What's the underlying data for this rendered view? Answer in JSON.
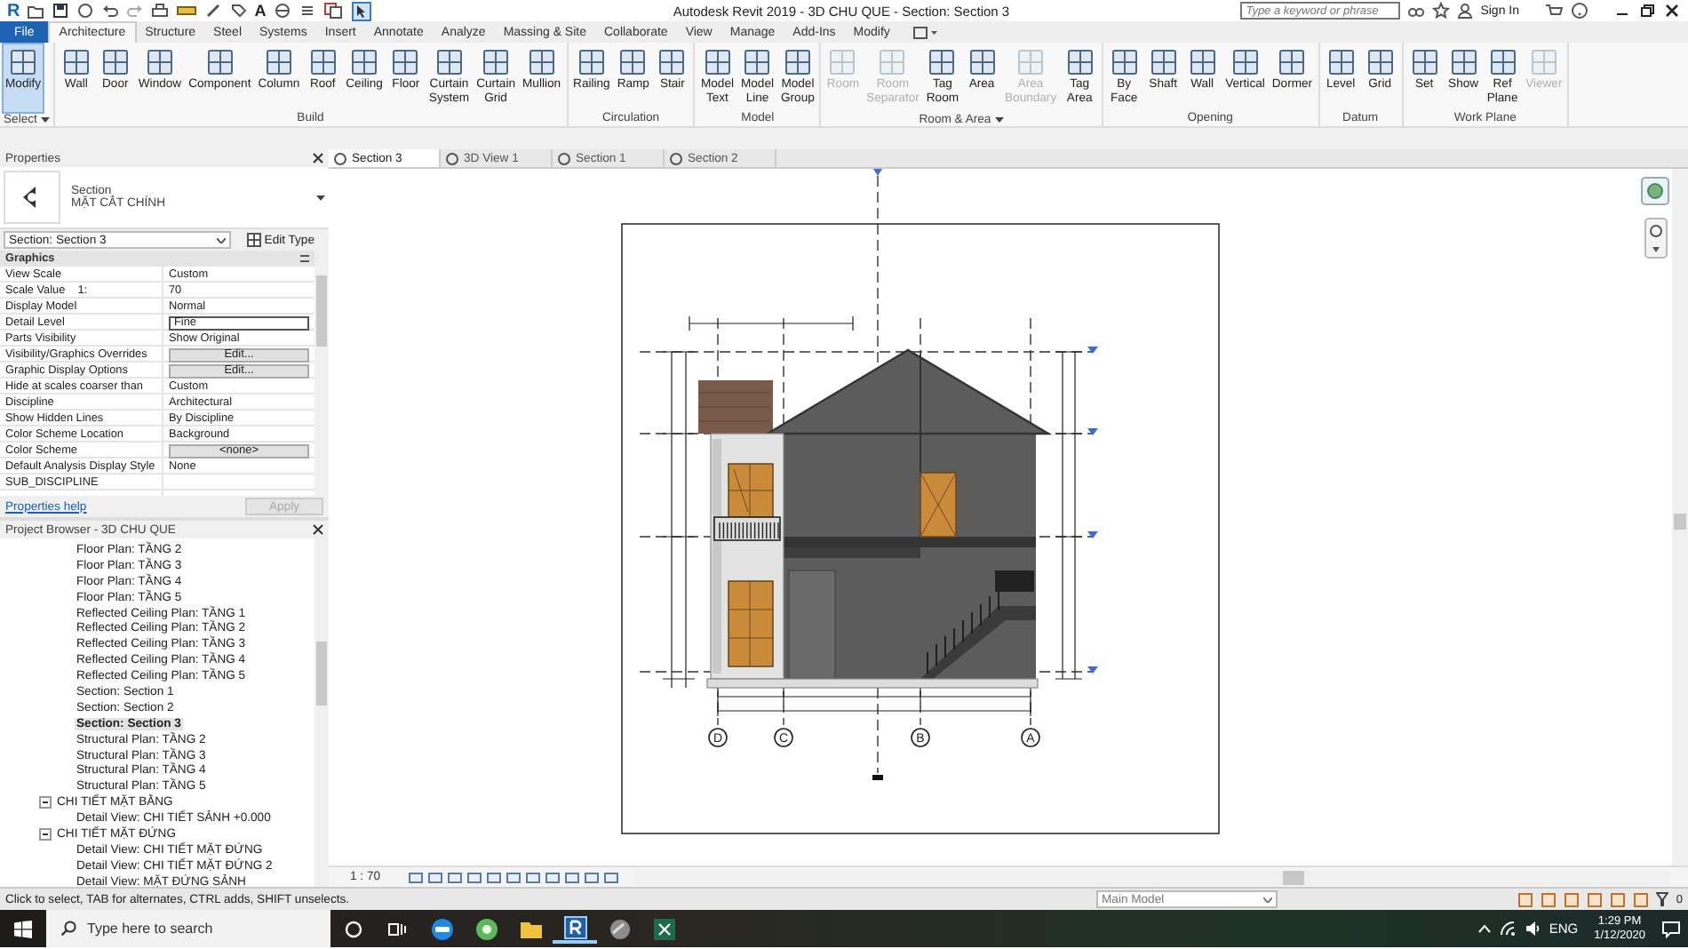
{
  "title_bar": {
    "logo": "R",
    "text_tool": "A",
    "title": "Autodesk Revit 2019 - 3D CHU QUE - Section: Section 3",
    "search_placeholder": "Type a keyword or phrase",
    "sign_in": "Sign In"
  },
  "ribbon_tabs": [
    {
      "label": "File",
      "kind": "file",
      "selected": false
    },
    {
      "label": "Architecture",
      "kind": "tab",
      "selected": true
    },
    {
      "label": "Structure",
      "kind": "tab",
      "selected": false
    },
    {
      "label": "Steel",
      "kind": "tab",
      "selected": false
    },
    {
      "label": "Systems",
      "kind": "tab",
      "selected": false
    },
    {
      "label": "Insert",
      "kind": "tab",
      "selected": false
    },
    {
      "label": "Annotate",
      "kind": "tab",
      "selected": false
    },
    {
      "label": "Analyze",
      "kind": "tab",
      "selected": false
    },
    {
      "label": "Massing & Site",
      "kind": "tab",
      "selected": false
    },
    {
      "label": "Collaborate",
      "kind": "tab",
      "selected": false
    },
    {
      "label": "View",
      "kind": "tab",
      "selected": false
    },
    {
      "label": "Manage",
      "kind": "tab",
      "selected": false
    },
    {
      "label": "Add-Ins",
      "kind": "tab",
      "selected": false
    },
    {
      "label": "Modify",
      "kind": "tab",
      "selected": false
    }
  ],
  "ribbon_groups": [
    {
      "label": "Select",
      "menu": true,
      "buttons": [
        {
          "label": "Modify",
          "selected": true,
          "disabled": false
        }
      ]
    },
    {
      "label": "Build",
      "menu": false,
      "buttons": [
        {
          "label": "Wall",
          "selected": false,
          "disabled": false
        },
        {
          "label": "Door",
          "selected": false,
          "disabled": false
        },
        {
          "label": "Window",
          "selected": false,
          "disabled": false
        },
        {
          "label": "Component",
          "selected": false,
          "disabled": false
        },
        {
          "label": "Column",
          "selected": false,
          "disabled": false
        },
        {
          "label": "Roof",
          "selected": false,
          "disabled": false
        },
        {
          "label": "Ceiling",
          "selected": false,
          "disabled": false
        },
        {
          "label": "Floor",
          "selected": false,
          "disabled": false
        },
        {
          "label": "Curtain System",
          "selected": false,
          "disabled": false
        },
        {
          "label": "Curtain Grid",
          "selected": false,
          "disabled": false
        },
        {
          "label": "Mullion",
          "selected": false,
          "disabled": false
        }
      ]
    },
    {
      "label": "Circulation",
      "menu": false,
      "buttons": [
        {
          "label": "Railing",
          "selected": false,
          "disabled": false
        },
        {
          "label": "Ramp",
          "selected": false,
          "disabled": false
        },
        {
          "label": "Stair",
          "selected": false,
          "disabled": false
        }
      ]
    },
    {
      "label": "Model",
      "menu": false,
      "buttons": [
        {
          "label": "Model Text",
          "selected": false,
          "disabled": false
        },
        {
          "label": "Model Line",
          "selected": false,
          "disabled": false
        },
        {
          "label": "Model Group",
          "selected": false,
          "disabled": false
        }
      ]
    },
    {
      "label": "Room & Area",
      "menu": true,
      "buttons": [
        {
          "label": "Room",
          "selected": false,
          "disabled": true
        },
        {
          "label": "Room Separator",
          "selected": false,
          "disabled": true
        },
        {
          "label": "Tag Room",
          "selected": false,
          "disabled": false
        },
        {
          "label": "Area",
          "selected": false,
          "disabled": false
        },
        {
          "label": "Area Boundary",
          "selected": false,
          "disabled": true
        },
        {
          "label": "Tag Area",
          "selected": false,
          "disabled": false
        }
      ]
    },
    {
      "label": "Opening",
      "menu": false,
      "buttons": [
        {
          "label": "By Face",
          "selected": false,
          "disabled": false
        },
        {
          "label": "Shaft",
          "selected": false,
          "disabled": false
        },
        {
          "label": "Wall",
          "selected": false,
          "disabled": false
        },
        {
          "label": "Vertical",
          "selected": false,
          "disabled": false
        },
        {
          "label": "Dormer",
          "selected": false,
          "disabled": false
        }
      ]
    },
    {
      "label": "Datum",
      "menu": false,
      "buttons": [
        {
          "label": "Level",
          "selected": false,
          "disabled": false
        },
        {
          "label": "Grid",
          "selected": false,
          "disabled": false
        }
      ]
    },
    {
      "label": "Work Plane",
      "menu": false,
      "buttons": [
        {
          "label": "Set",
          "selected": false,
          "disabled": false
        },
        {
          "label": "Show",
          "selected": false,
          "disabled": false
        },
        {
          "label": "Ref Plane",
          "selected": false,
          "disabled": false
        },
        {
          "label": "Viewer",
          "selected": false,
          "disabled": true
        }
      ]
    }
  ],
  "properties": {
    "title": "Properties",
    "type_category": "Section",
    "type_name": "MẶT CẮT CHÍNH",
    "instance_selector": "Section: Section 3",
    "edit_type": "Edit Type",
    "group": "Graphics",
    "rows": [
      {
        "name": "View Scale",
        "value": "Custom",
        "kind": "text"
      },
      {
        "name": "Scale Value    1:",
        "value": "70",
        "kind": "text"
      },
      {
        "name": "Display Model",
        "value": "Normal",
        "kind": "text"
      },
      {
        "name": "Detail Level",
        "value": "Fine",
        "kind": "field"
      },
      {
        "name": "Parts Visibility",
        "value": "Show Original",
        "kind": "text"
      },
      {
        "name": "Visibility/Graphics Overrides",
        "value": "Edit...",
        "kind": "button"
      },
      {
        "name": "Graphic Display Options",
        "value": "Edit...",
        "kind": "button"
      },
      {
        "name": "Hide at scales coarser than",
        "value": "Custom",
        "kind": "text"
      },
      {
        "name": "Discipline",
        "value": "Architectural",
        "kind": "text"
      },
      {
        "name": "Show Hidden Lines",
        "value": "By Discipline",
        "kind": "text"
      },
      {
        "name": "Color Scheme Location",
        "value": "Background",
        "kind": "text"
      },
      {
        "name": "Color Scheme",
        "value": "<none>",
        "kind": "button"
      },
      {
        "name": "Default Analysis Display Style",
        "value": "None",
        "kind": "text"
      },
      {
        "name": "SUB_DISCIPLINE",
        "kind": "blank"
      }
    ],
    "help_link": "Properties help",
    "apply": {
      "label": "Apply",
      "disabled": true
    }
  },
  "project_browser": {
    "title": "Project Browser - 3D CHU QUE",
    "items": [
      {
        "label": "Floor Plan: TẦNG 2",
        "selected": false
      },
      {
        "label": "Floor Plan: TẦNG 3",
        "selected": false
      },
      {
        "label": "Floor Plan: TẦNG 4",
        "selected": false
      },
      {
        "label": "Floor Plan: TẦNG 5",
        "selected": false
      },
      {
        "label": "Reflected Ceiling Plan: TẦNG 1",
        "selected": false
      },
      {
        "label": "Reflected Ceiling Plan: TẦNG 2",
        "selected": false
      },
      {
        "label": "Reflected Ceiling Plan: TẦNG 3",
        "selected": false
      },
      {
        "label": "Reflected Ceiling Plan: TẦNG 4",
        "selected": false
      },
      {
        "label": "Reflected Ceiling Plan: TẦNG 5",
        "selected": false
      },
      {
        "label": "Section: Section 1",
        "selected": false
      },
      {
        "label": "Section: Section 2",
        "selected": false
      },
      {
        "label": "Section: Section 3",
        "selected": true
      },
      {
        "label": "Structural Plan: TẦNG 2",
        "selected": false
      },
      {
        "label": "Structural Plan: TẦNG 3",
        "selected": false
      },
      {
        "label": "Structural Plan: TẦNG 4",
        "selected": false
      },
      {
        "label": "Structural Plan: TẦNG 5",
        "selected": false
      },
      {
        "label": "CHI TIẾT MẶT BẰNG",
        "expanded": true,
        "children": [
          {
            "label": "Detail View: CHI TIẾT SẢNH +0.000",
            "selected": false
          }
        ]
      },
      {
        "label": "CHI TIẾT MẶT ĐỨNG",
        "expanded": true,
        "children": [
          {
            "label": "Detail View: CHI TIẾT MẶT ĐỨNG",
            "selected": false
          },
          {
            "label": "Detail View: CHI TIẾT MẶT ĐỨNG 2",
            "selected": false
          },
          {
            "label": "Detail View: MẶT ĐỨNG SẢNH",
            "selected": false
          }
        ]
      }
    ]
  },
  "view_tabs": [
    {
      "label": "Section 3",
      "selected": true
    },
    {
      "label": "3D View 1",
      "selected": false
    },
    {
      "label": "Section 1",
      "selected": false
    },
    {
      "label": "Section 2",
      "selected": false
    }
  ],
  "drawing": {
    "grid_labels": [
      "D",
      "C",
      "B",
      "A"
    ]
  },
  "view_control": {
    "scale": "1 : 70"
  },
  "status_bar": {
    "message": "Click to select, TAB for alternates, CTRL adds, SHIFT unselects.",
    "workset": "Main Model",
    "filter_count": "0"
  },
  "taskbar": {
    "search_placeholder": "Type here to search",
    "language": "ENG",
    "time": "1:29 PM",
    "date": "1/12/2020"
  }
}
